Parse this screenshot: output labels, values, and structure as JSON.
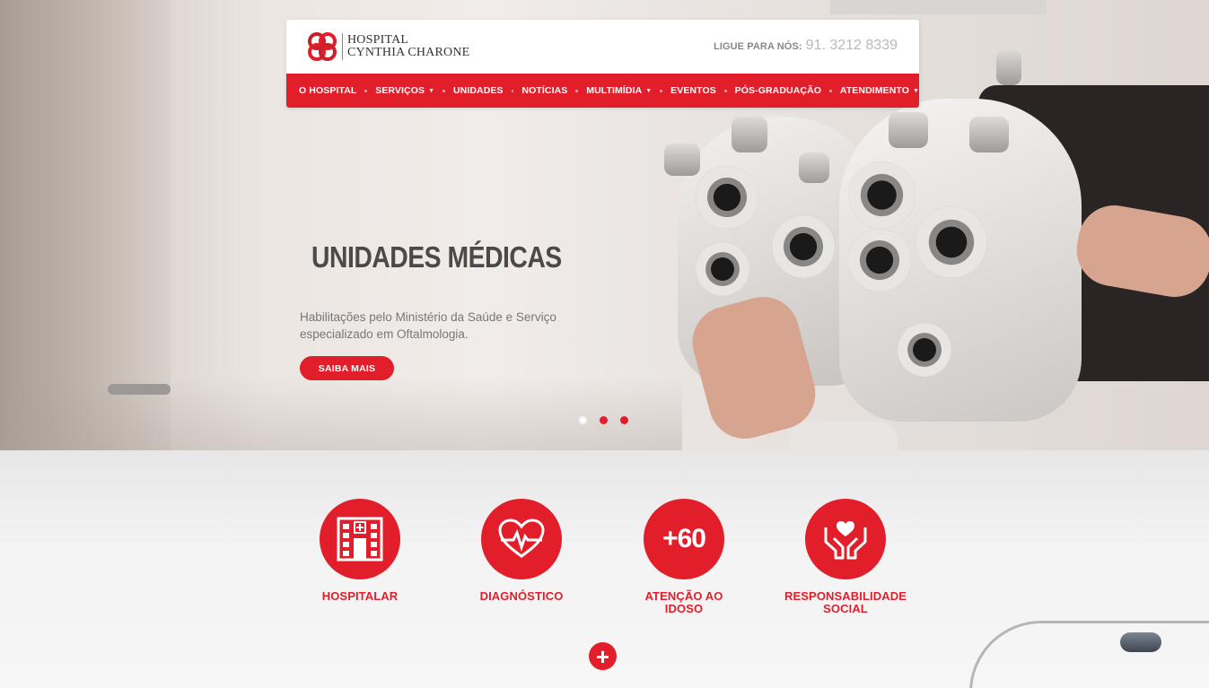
{
  "header": {
    "logo": {
      "line1": "HOSPITAL",
      "line2": "CYNTHIA CHARONE"
    },
    "phone": {
      "label": "LIGUE PARA NÓS:",
      "number": "91. 3212 8339"
    },
    "nav": [
      {
        "label": "O HOSPITAL",
        "dropdown": false
      },
      {
        "label": "SERVIÇOS",
        "dropdown": true
      },
      {
        "label": "UNIDADES",
        "dropdown": false
      },
      {
        "label": "NOTÍCIAS",
        "dropdown": false
      },
      {
        "label": "MULTIMÍDIA",
        "dropdown": true
      },
      {
        "label": "EVENTOS",
        "dropdown": false
      },
      {
        "label": "PÓS-GRADUAÇÃO",
        "dropdown": false
      },
      {
        "label": "ATENDIMENTO",
        "dropdown": true
      }
    ]
  },
  "hero": {
    "title": "UNIDADES MÉDICAS",
    "subtitle": "Habilitações pelo Ministério da Saúde e Serviço especializado em Oftalmologia.",
    "button": "SAIBA MAIS",
    "slides": 3,
    "active_slide": 1
  },
  "features": {
    "items": [
      {
        "icon": "hospital-building-icon",
        "label": "HOSPITALAR"
      },
      {
        "icon": "heart-pulse-icon",
        "label": "DIAGNÓSTICO"
      },
      {
        "icon": "plus-60-icon",
        "icon_text": "+60",
        "label": "ATENÇÃO AO IDOSO"
      },
      {
        "icon": "hands-heart-icon",
        "label": "RESPONSABILIDADE SOCIAL"
      }
    ],
    "more_button": "+"
  },
  "colors": {
    "brand_red": "#e31e2b",
    "text_dark": "#4a4a4a",
    "text_muted": "#777777"
  }
}
